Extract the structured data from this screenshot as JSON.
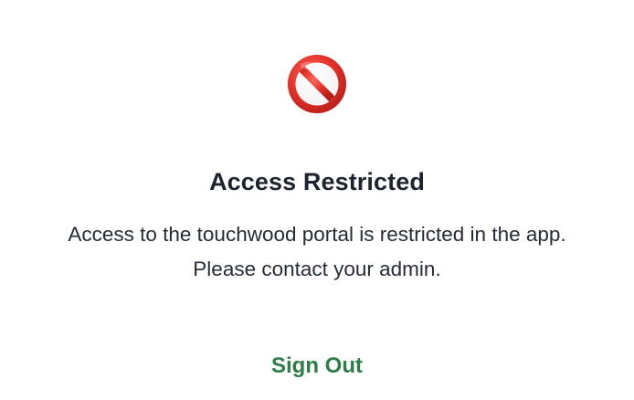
{
  "icon": {
    "name": "prohibited-icon",
    "color": "#e0322d"
  },
  "title": "Access Restricted",
  "message": "Access to the touchwood portal is restricted in the app. Please contact your admin.",
  "signout_label": "Sign Out",
  "colors": {
    "title": "#1d2430",
    "body": "#262c36",
    "accent": "#2e7d46",
    "background": "#ffffff"
  }
}
